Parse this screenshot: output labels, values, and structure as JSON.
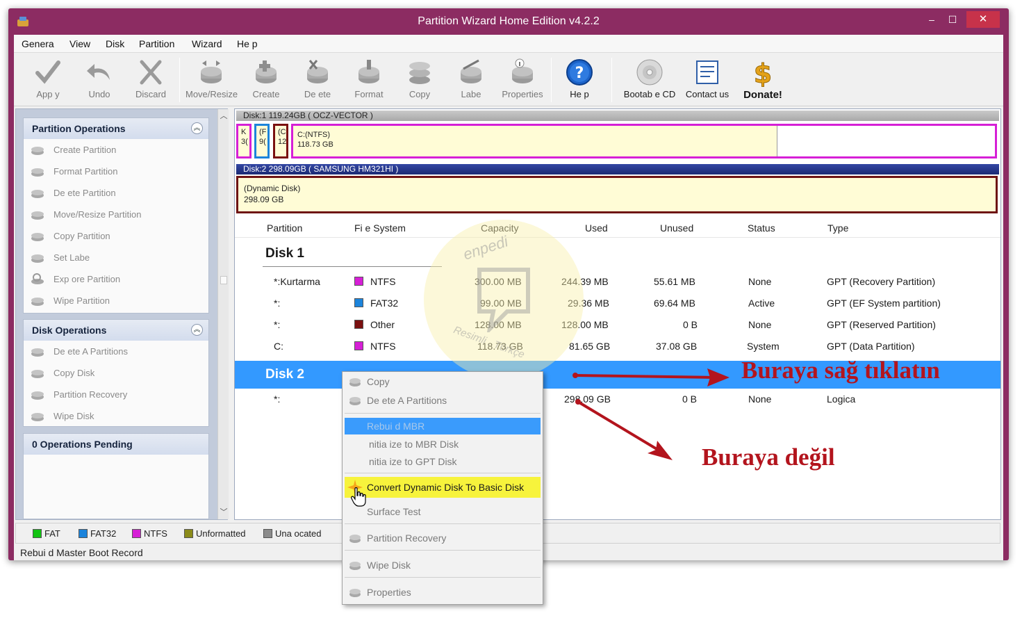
{
  "window": {
    "title": "Partition Wizard Home Edition v4.2.2",
    "min": "‒",
    "max": "☐",
    "close": "✕"
  },
  "menu": [
    "Genera",
    "View",
    "Disk",
    "Partition",
    "Wizard",
    "He p"
  ],
  "toolbar": {
    "apply": "App y",
    "undo": "Undo",
    "discard": "Discard",
    "move_resize": "Move/Resize",
    "create": "Create",
    "delete": "De ete",
    "format": "Format",
    "copy": "Copy",
    "label": "Labe",
    "properties": "Properties",
    "help": "He p",
    "bootable_cd": "Bootab e CD",
    "contact_us": "Contact us",
    "donate": "Donate!"
  },
  "partition_ops": {
    "title": "Partition Operations",
    "items": [
      "Create Partition",
      "Format Partition",
      "De ete Partition",
      "Move/Resize Partition",
      "Copy Partition",
      "Set Labe",
      "Exp ore Partition",
      "Wipe Partition"
    ]
  },
  "disk_ops": {
    "title": "Disk Operations",
    "items": [
      "De ete A  Partitions",
      "Copy Disk",
      "Partition Recovery",
      "Wipe Disk"
    ]
  },
  "pending": "0 Operations Pending",
  "diskmap": {
    "disk1_header": "Disk:1 119.24GB  ( OCZ-VECTOR )",
    "disk1_small": [
      "K",
      "3(",
      "(F",
      "9(",
      "(C",
      "12"
    ],
    "disk1_c_name": "C:(NTFS)",
    "disk1_c_size": "118.73 GB",
    "disk2_header": "Disk:2 298.09GB  ( SAMSUNG HM321HI )",
    "disk2_name": "(Dynamic Disk)",
    "disk2_size": "298.09 GB"
  },
  "columns": [
    "Partition",
    "Fi e System",
    "Capacity",
    "Used",
    "Unused",
    "Status",
    "Type"
  ],
  "disk1_label": "Disk 1",
  "disk2_label": "Disk 2",
  "rows": [
    {
      "partition": "*:Kurtarma",
      "fs": "NTFS",
      "capacity": "300.00 MB",
      "used": "244.39 MB",
      "unused": "55.61 MB",
      "status": "None",
      "type": "GPT (Recovery Partition)"
    },
    {
      "partition": "*:",
      "fs": "FAT32",
      "capacity": "99.00 MB",
      "used": "29.36 MB",
      "unused": "69.64 MB",
      "status": "Active",
      "type": "GPT (EF  System partition)"
    },
    {
      "partition": "*:",
      "fs": "Other",
      "capacity": "128.00 MB",
      "used": "128.00 MB",
      "unused": "0 B",
      "status": "None",
      "type": "GPT (Reserved Partition)"
    },
    {
      "partition": "C:",
      "fs": "NTFS",
      "capacity": "118.73 GB",
      "used": "81.65 GB",
      "unused": "37.08 GB",
      "status": "System",
      "type": "GPT (Data Partition)"
    }
  ],
  "disk2_row": {
    "partition": "*:",
    "used": "298.09 GB",
    "unused": "0 B",
    "status": "None",
    "type": "Logica"
  },
  "legend": [
    "FAT",
    "FAT32",
    "NTFS",
    "Unformatted",
    "Una ocated"
  ],
  "status_text": "Rebui d Master Boot Record",
  "context_menu": {
    "copy": "Copy",
    "delete_all": "De ete A   Partitions",
    "rebuild_mbr": "Rebui d MBR",
    "init_mbr": "nitia ize to MBR Disk",
    "init_gpt": "nitia ize to GPT Disk",
    "convert": "Convert Dynamic Disk To Basic Disk",
    "surface_test": "Surface Test",
    "partition_recovery": "Partition Recovery",
    "wipe_disk": "Wipe Disk",
    "properties": "Properties"
  },
  "annotations": {
    "right_click_here": "Buraya sağ tıklatın",
    "not_here": "Buraya değil"
  },
  "watermark": {
    "brand": "enpedi",
    "slogan": "Resimli . Türkçe"
  },
  "colors": {
    "fat": "#13c413",
    "fat32": "#1c84db",
    "ntfs": "#d61fd6",
    "unformatted": "#8b8b1a",
    "unallocated": "#8c8c8c",
    "other": "#7a1010",
    "selection": "#3399ff",
    "annotation": "#b3141d"
  }
}
